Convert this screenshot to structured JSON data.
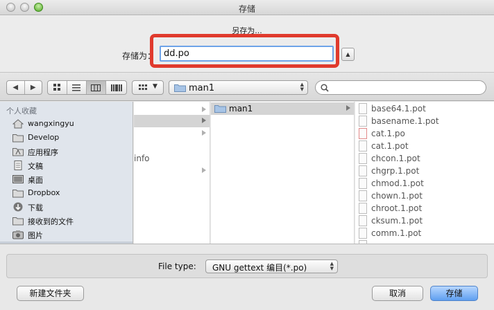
{
  "window": {
    "title": "存储"
  },
  "dialog": {
    "subtitle": "另存为...",
    "save_as_label": "存储为：",
    "filename_value": "dd.po"
  },
  "toolbar": {
    "back_icon": "chevron-left-icon",
    "forward_icon": "chevron-right-icon",
    "views": [
      "icon-view",
      "list-view",
      "column-view",
      "coverflow-view"
    ],
    "active_view": "column-view",
    "path": "man1",
    "search_placeholder": ""
  },
  "sidebar": {
    "header": "个人收藏",
    "items": [
      {
        "label": "wangxingyu",
        "icon": "home-icon"
      },
      {
        "label": "Develop",
        "icon": "folder-icon"
      },
      {
        "label": "应用程序",
        "icon": "applications-icon"
      },
      {
        "label": "文稿",
        "icon": "documents-icon"
      },
      {
        "label": "桌面",
        "icon": "desktop-icon"
      },
      {
        "label": "Dropbox",
        "icon": "folder-icon"
      },
      {
        "label": "下载",
        "icon": "downloads-icon"
      },
      {
        "label": "接收到的文件",
        "icon": "folder-icon"
      },
      {
        "label": "图片",
        "icon": "camera-icon"
      }
    ]
  },
  "columns": {
    "col1": {
      "partial_text": "info"
    },
    "col2": {
      "selected": "man1"
    },
    "col3": {
      "files": [
        "base64.1.pot",
        "basename.1.pot",
        "cat.1.po",
        "cat.1.pot",
        "chcon.1.pot",
        "chgrp.1.pot",
        "chmod.1.pot",
        "chown.1.pot",
        "chroot.1.pot",
        "cksum.1.pot",
        "comm.1.pot"
      ]
    }
  },
  "footer": {
    "file_type_label": "File type:",
    "file_type_value": "GNU gettext 编目(*.po)",
    "new_folder_label": "新建文件夹",
    "cancel_label": "取消",
    "save_label": "存储"
  },
  "colors": {
    "highlight_frame": "#e03a2d",
    "focus_ring": "#6ea3e8",
    "primary_button": "#5f9ff0"
  }
}
